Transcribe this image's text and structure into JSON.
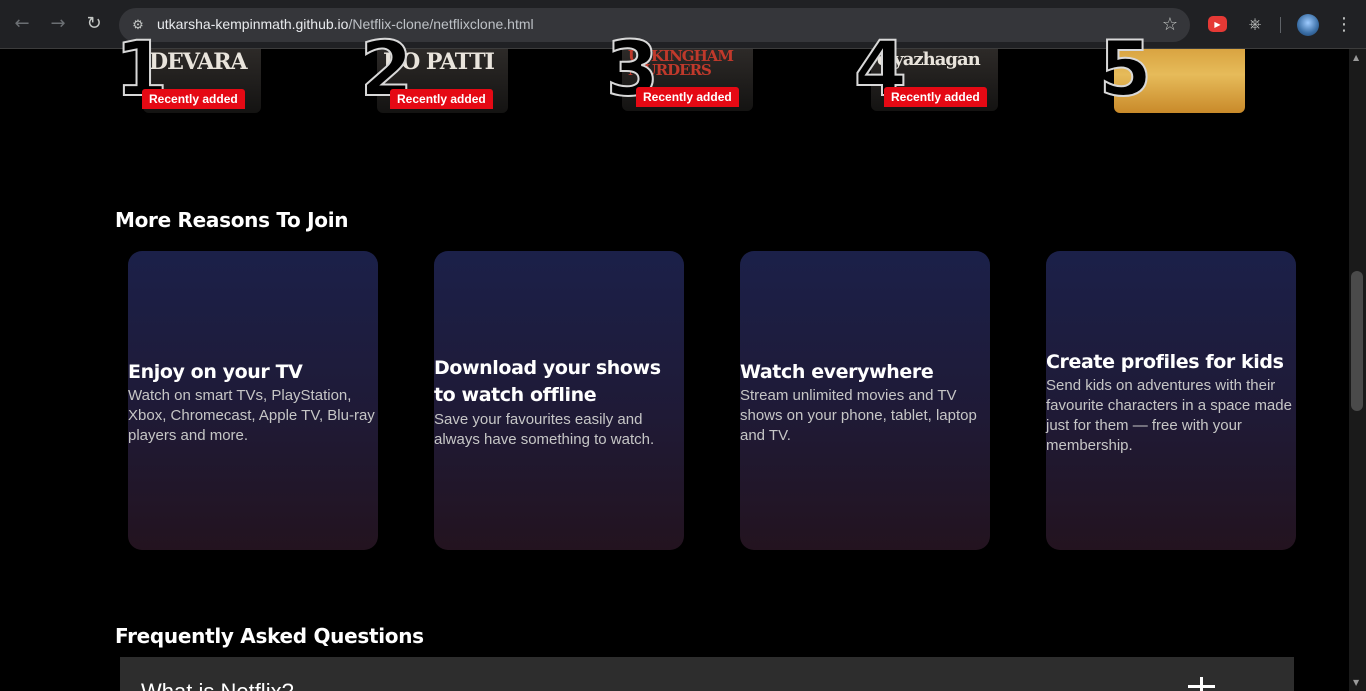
{
  "browser": {
    "url_host": "utkarsha-kempinmath.github.io",
    "url_path": "/Netflix-clone/netflixclone.html",
    "icons": {
      "back": "arrow-left",
      "forward": "arrow-right",
      "reload": "reload",
      "site_info": "tune",
      "bookmark": "star",
      "extension": "youtube-extension",
      "extensions": "puzzle",
      "profile": "avatar",
      "menu": "kebab-menu"
    }
  },
  "trending": {
    "items": [
      {
        "rank": "1",
        "title": "DEVARA",
        "badge": "Recently added"
      },
      {
        "rank": "2",
        "title": "DO PATTI",
        "badge": "Recently added"
      },
      {
        "rank": "3",
        "title": "UCKINGHAM MURDERS",
        "badge": "Recently added"
      },
      {
        "rank": "4",
        "title": "eiyazhagan",
        "badge": "Recently added"
      },
      {
        "rank": "5",
        "title": "",
        "badge": ""
      }
    ]
  },
  "reasons": {
    "title": "More Reasons To Join",
    "cards": [
      {
        "title": "Enjoy on your TV",
        "desc": "Watch on smart TVs, PlayStation, Xbox, Chromecast, Apple TV, Blu-ray players and more."
      },
      {
        "title": "Download your shows to watch offline",
        "desc": "Save your favourites easily and always have something to watch."
      },
      {
        "title": "Watch everywhere",
        "desc": "Stream unlimited movies and TV shows on your phone, tablet, laptop and TV."
      },
      {
        "title": "Create profiles for kids",
        "desc": "Send kids on adventures with their favourite characters in a space made just for them — free with your membership."
      }
    ]
  },
  "faq": {
    "title": "Frequently Asked Questions",
    "items": [
      {
        "question": "What is Netflix?"
      }
    ]
  },
  "colors": {
    "accent": "#e50914",
    "card_top": "#1b2049",
    "card_bottom": "#23131f",
    "faq_bg": "#2d2d2d"
  }
}
